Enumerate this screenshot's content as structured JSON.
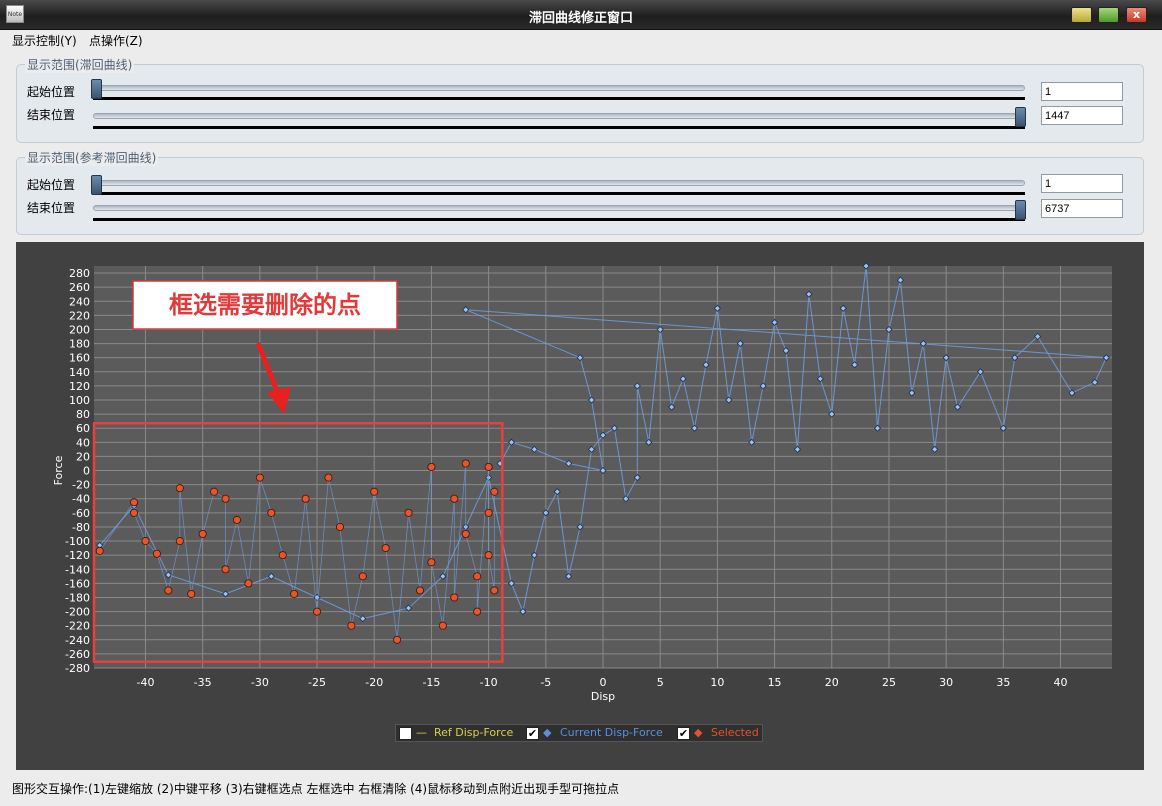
{
  "window": {
    "title": "滞回曲线修正窗口",
    "icon_text": "Note",
    "close_glyph": "x"
  },
  "menu": [
    {
      "label": "显示控制(Y)"
    },
    {
      "label": "点操作(Z)"
    }
  ],
  "range_primary": {
    "title": "显示范围(滞回曲线)",
    "start_label": "起始位置",
    "start_value": "1",
    "end_label": "结束位置",
    "end_value": "1447",
    "start_fraction": 0.0,
    "end_fraction": 1.0
  },
  "range_reference": {
    "title": "显示范围(参考滞回曲线)",
    "start_label": "起始位置",
    "start_value": "1",
    "end_label": "结束位置",
    "end_value": "6737",
    "start_fraction": 0.0,
    "end_fraction": 1.0
  },
  "annotation": {
    "text": "框选需要删除的点"
  },
  "chart_data": {
    "type": "scatter",
    "xlabel": "Disp",
    "ylabel": "Force",
    "xlim": [
      -44.5,
      44.5
    ],
    "ylim": [
      -280,
      290
    ],
    "xticks": [
      -40,
      -35,
      -30,
      -25,
      -20,
      -15,
      -10,
      -5,
      0,
      5,
      10,
      15,
      20,
      25,
      30,
      35,
      40
    ],
    "yticks": [
      280,
      260,
      240,
      220,
      200,
      180,
      160,
      140,
      120,
      100,
      80,
      60,
      40,
      20,
      0,
      -20,
      -40,
      -60,
      -80,
      -100,
      -120,
      -140,
      -160,
      -180,
      -200,
      -220,
      -240,
      -260,
      -280
    ],
    "grid": true,
    "selection_box": {
      "x": [
        -44.5,
        -8.8
      ],
      "y": [
        -271,
        67
      ]
    },
    "series": [
      {
        "name": "Ref Disp-Force",
        "visible": false,
        "color": "#e6e060"
      },
      {
        "name": "Current Disp-Force",
        "visible": true,
        "color": "#6fa0e6",
        "points": [
          [
            -44,
            -106
          ],
          [
            -41,
            -50
          ],
          [
            -38,
            -148
          ],
          [
            -33,
            -175
          ],
          [
            -29,
            -150
          ],
          [
            -25,
            -180
          ],
          [
            -21,
            -210
          ],
          [
            -17,
            -195
          ],
          [
            -14,
            -150
          ],
          [
            -12,
            -80
          ],
          [
            -10,
            -10
          ],
          [
            -8,
            -160
          ],
          [
            -7,
            -200
          ],
          [
            -6,
            -120
          ],
          [
            -5,
            -60
          ],
          [
            -4,
            -30
          ],
          [
            -3,
            -150
          ],
          [
            -2,
            -80
          ],
          [
            -1,
            30
          ],
          [
            0,
            50
          ],
          [
            1,
            60
          ],
          [
            2,
            -40
          ],
          [
            3,
            -10
          ],
          [
            3,
            120
          ],
          [
            4,
            40
          ],
          [
            5,
            200
          ],
          [
            6,
            90
          ],
          [
            7,
            130
          ],
          [
            8,
            60
          ],
          [
            9,
            150
          ],
          [
            10,
            230
          ],
          [
            11,
            100
          ],
          [
            12,
            180
          ],
          [
            13,
            40
          ],
          [
            14,
            120
          ],
          [
            15,
            210
          ],
          [
            16,
            170
          ],
          [
            17,
            30
          ],
          [
            18,
            250
          ],
          [
            19,
            130
          ],
          [
            20,
            80
          ],
          [
            21,
            230
          ],
          [
            22,
            150
          ],
          [
            23,
            290
          ],
          [
            24,
            60
          ],
          [
            25,
            200
          ],
          [
            26,
            270
          ],
          [
            27,
            110
          ],
          [
            28,
            180
          ],
          [
            29,
            30
          ],
          [
            30,
            160
          ],
          [
            31,
            90
          ],
          [
            33,
            140
          ],
          [
            35,
            60
          ],
          [
            36,
            160
          ],
          [
            38,
            190
          ],
          [
            41,
            110
          ],
          [
            43,
            125
          ],
          [
            44,
            160
          ],
          [
            -12,
            228
          ],
          [
            -2,
            160
          ],
          [
            -1,
            100
          ],
          [
            0,
            0
          ],
          [
            -3,
            10
          ],
          [
            -6,
            30
          ],
          [
            -8,
            40
          ],
          [
            -9,
            10
          ]
        ]
      },
      {
        "name": "Selected",
        "visible": true,
        "color": "#e8552a",
        "points": [
          [
            -44,
            -114
          ],
          [
            -41,
            -45
          ],
          [
            -41,
            -60
          ],
          [
            -40,
            -100
          ],
          [
            -39,
            -118
          ],
          [
            -38,
            -170
          ],
          [
            -37,
            -100
          ],
          [
            -37,
            -25
          ],
          [
            -36,
            -175
          ],
          [
            -35,
            -90
          ],
          [
            -34,
            -30
          ],
          [
            -33,
            -40
          ],
          [
            -33,
            -140
          ],
          [
            -32,
            -70
          ],
          [
            -31,
            -160
          ],
          [
            -30,
            -10
          ],
          [
            -29,
            -60
          ],
          [
            -28,
            -120
          ],
          [
            -27,
            -175
          ],
          [
            -26,
            -40
          ],
          [
            -25,
            -200
          ],
          [
            -24,
            -10
          ],
          [
            -23,
            -80
          ],
          [
            -22,
            -220
          ],
          [
            -21,
            -150
          ],
          [
            -20,
            -30
          ],
          [
            -19,
            -110
          ],
          [
            -18,
            -240
          ],
          [
            -17,
            -60
          ],
          [
            -16,
            -170
          ],
          [
            -15,
            5
          ],
          [
            -15,
            -130
          ],
          [
            -14,
            -220
          ],
          [
            -13,
            -40
          ],
          [
            -13,
            -180
          ],
          [
            -12,
            10
          ],
          [
            -12,
            -90
          ],
          [
            -11,
            -150
          ],
          [
            -11,
            -200
          ],
          [
            -10,
            5
          ],
          [
            -10,
            -60
          ],
          [
            -10,
            -120
          ],
          [
            -9.5,
            -170
          ],
          [
            -9.5,
            -30
          ]
        ]
      }
    ]
  },
  "legend": {
    "items": [
      {
        "label": "Ref Disp-Force",
        "checked": false,
        "color": "#d9d04a"
      },
      {
        "label": "Current Disp-Force",
        "checked": true,
        "color": "#5a8ee0"
      },
      {
        "label": "Selected",
        "checked": true,
        "color": "#e0552a"
      }
    ],
    "check_glyph": "✔"
  },
  "statusbar": {
    "text": "图形交互操作:(1)左键缩放 (2)中键平移 (3)右键框选点 左框选中 右框清除 (4)鼠标移动到点附近出现手型可拖拉点"
  }
}
